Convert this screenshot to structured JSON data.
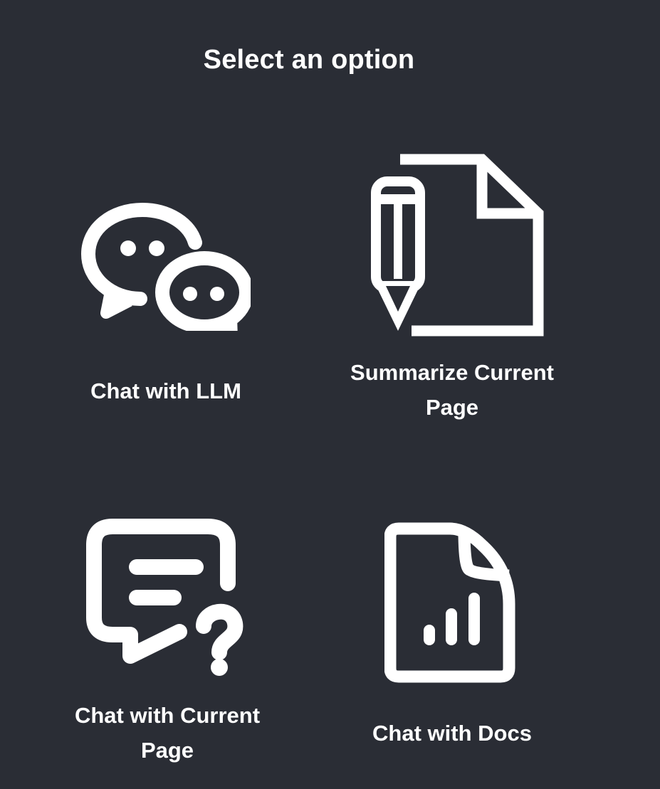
{
  "header": {
    "title": "Select an option"
  },
  "options": [
    {
      "label": "Chat with LLM",
      "icon": "chat-bubbles-icon"
    },
    {
      "label": "Summarize Current Page",
      "icon": "document-pencil-icon"
    },
    {
      "label": "Chat with Current Page",
      "icon": "message-question-icon"
    },
    {
      "label": "Chat with Docs",
      "icon": "document-chart-icon"
    }
  ],
  "colors": {
    "background": "#2a2d35",
    "foreground": "#ffffff"
  }
}
